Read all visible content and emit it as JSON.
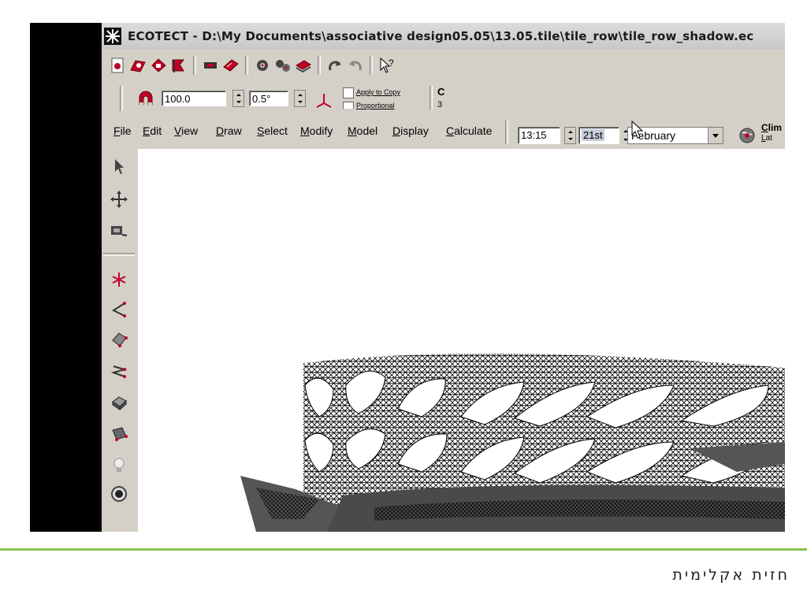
{
  "window": {
    "title": "ECOTECT - D:\\My Documents\\associative design05.05\\13.05.tile\\tile_row\\tile_row_shadow.ec"
  },
  "toolbar_top": {
    "icons": [
      "new-file-icon",
      "open-file-icon",
      "save-file-icon",
      "save-as-icon",
      "render-icon",
      "book-icon",
      "gear-icon",
      "settings-icon",
      "layers-icon",
      "undo-icon",
      "redo-icon",
      "help-icon"
    ]
  },
  "toolbar_transform": {
    "distance_value": "100.0",
    "angle_value": "0.5°",
    "apply_to_copy_label": "Apply to Copy",
    "proportional_label": "Proportional",
    "extra_letter": "C",
    "extra_digit": "3"
  },
  "menu": {
    "items": [
      "File",
      "Edit",
      "View",
      "Draw",
      "Select",
      "Modify",
      "Model",
      "Display",
      "Calculate"
    ]
  },
  "sun": {
    "time": "13:15",
    "day": "21st",
    "month": "February",
    "climate_label": "Clim",
    "climate_sub": "Lat"
  },
  "left_tools": {
    "icons": [
      "pointer-icon",
      "move-icon",
      "zoom-icon",
      "point-icon",
      "line-icon",
      "plane-icon",
      "polyline-icon",
      "box-icon",
      "surface-icon",
      "light-icon",
      "speaker-icon"
    ]
  },
  "footer": {
    "caption": "חזית אקלימית",
    "accent_color": "#8cc151"
  }
}
